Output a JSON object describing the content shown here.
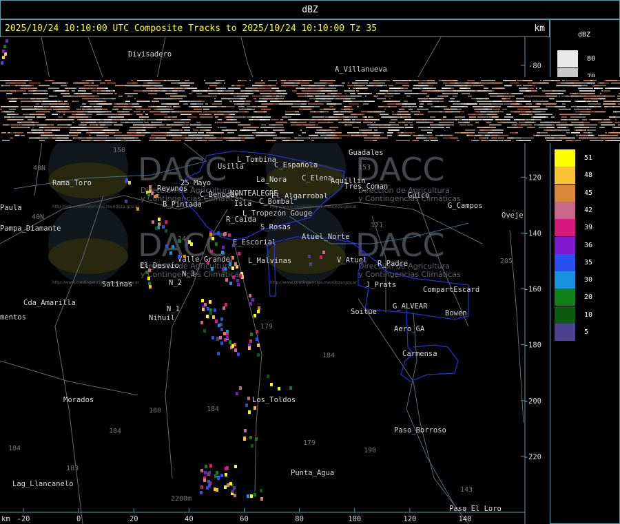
{
  "title": "dBZ",
  "header": {
    "text": "2025/10/24 10:10:00 UTC Composite Tracks to 2025/10/24 10:10:00 Tz 35",
    "unit": "km"
  },
  "legend": {
    "title": "dBZ",
    "top_entries": [
      {
        "label": "80",
        "color": "#e8e8e8"
      },
      {
        "label": "70",
        "color": "#c8c8c8"
      }
    ],
    "entries": [
      {
        "label": "51",
        "color": "#ffff00"
      },
      {
        "label": "48",
        "color": "#f7c330"
      },
      {
        "label": "45",
        "color": "#d88838"
      },
      {
        "label": "42",
        "color": "#c86888"
      },
      {
        "label": "39",
        "color": "#d8187c"
      },
      {
        "label": "36",
        "color": "#8018d0"
      },
      {
        "label": "35",
        "color": "#2850f0"
      },
      {
        "label": "30",
        "color": "#1890e0"
      },
      {
        "label": "20",
        "color": "#108018"
      },
      {
        "label": "10",
        "color": "#0a5a10"
      },
      {
        "label": "5",
        "color": "#504090"
      }
    ]
  },
  "axes": {
    "x_ticks": [
      "-20",
      "0",
      "20",
      "40",
      "60",
      "80",
      "100",
      "120",
      "140"
    ],
    "y_ticks": [
      "-80",
      "-120",
      "-140",
      "-160",
      "-180",
      "-200",
      "-220"
    ],
    "x_unit": "km"
  },
  "places": [
    {
      "name": "Divisadero",
      "x": 186,
      "y": 28
    },
    {
      "name": "A_Villanueva",
      "x": 486,
      "y": 50
    },
    {
      "name": "Guadales",
      "x": 506,
      "y": 171
    },
    {
      "name": "L_Tombina",
      "x": 344,
      "y": 181
    },
    {
      "name": "Usilla",
      "x": 316,
      "y": 191
    },
    {
      "name": "C_Española",
      "x": 398,
      "y": 189
    },
    {
      "name": "La_Nora",
      "x": 372,
      "y": 210
    },
    {
      "name": "C_Elena",
      "x": 438,
      "y": 208
    },
    {
      "name": "Aquillin",
      "x": 480,
      "y": 212
    },
    {
      "name": "Tres_Coman",
      "x": 500,
      "y": 220
    },
    {
      "name": "Rama_Toro",
      "x": 76,
      "y": 215
    },
    {
      "name": "25_Mayo",
      "x": 262,
      "y": 215
    },
    {
      "name": "Reyunos",
      "x": 228,
      "y": 223
    },
    {
      "name": "C_Benogar",
      "x": 290,
      "y": 232
    },
    {
      "name": "MONTEALEGRE",
      "x": 334,
      "y": 230
    },
    {
      "name": "El_Algarrobal",
      "x": 394,
      "y": 234
    },
    {
      "name": "Guico",
      "x": 592,
      "y": 233
    },
    {
      "name": "G_Campos",
      "x": 650,
      "y": 248
    },
    {
      "name": "Oveje",
      "x": 728,
      "y": 262
    },
    {
      "name": "C_Bombal",
      "x": 376,
      "y": 242
    },
    {
      "name": "B_Pintada",
      "x": 236,
      "y": 246
    },
    {
      "name": "Isla",
      "x": 340,
      "y": 245
    },
    {
      "name": "L_Tropezón Gouge",
      "x": 352,
      "y": 259
    },
    {
      "name": "Paula",
      "x": 0,
      "y": 251
    },
    {
      "name": "R_Caída",
      "x": 328,
      "y": 268
    },
    {
      "name": "Pampa_Diamante",
      "x": 0,
      "y": 281
    },
    {
      "name": "S_Rosas",
      "x": 378,
      "y": 279
    },
    {
      "name": "Atuel_Norte",
      "x": 438,
      "y": 293
    },
    {
      "name": "E_Escorial",
      "x": 338,
      "y": 301
    },
    {
      "name": "Valle_Grande",
      "x": 258,
      "y": 326
    },
    {
      "name": "L_Malvinas",
      "x": 360,
      "y": 328
    },
    {
      "name": "V_Atuel",
      "x": 489,
      "y": 327
    },
    {
      "name": "R_Padre",
      "x": 548,
      "y": 332
    },
    {
      "name": "El_Desvío",
      "x": 203,
      "y": 335
    },
    {
      "name": "N_3",
      "x": 264,
      "y": 347
    },
    {
      "name": "Salinas",
      "x": 148,
      "y": 362
    },
    {
      "name": "N_2",
      "x": 245,
      "y": 360
    },
    {
      "name": "J_Prats",
      "x": 531,
      "y": 363
    },
    {
      "name": "CompartEscard",
      "x": 614,
      "y": 370
    },
    {
      "name": "Cda_Amarilla",
      "x": 34,
      "y": 389
    },
    {
      "name": "G_ALVEAR",
      "x": 570,
      "y": 394
    },
    {
      "name": "N_1",
      "x": 242,
      "y": 398
    },
    {
      "name": "Soitue",
      "x": 509,
      "y": 402
    },
    {
      "name": "Bowen",
      "x": 646,
      "y": 404
    },
    {
      "name": "mentos",
      "x": 0,
      "y": 410
    },
    {
      "name": "Nihuil",
      "x": 216,
      "y": 411
    },
    {
      "name": "Aero_GA",
      "x": 572,
      "y": 427
    },
    {
      "name": "Carmensa",
      "x": 584,
      "y": 463
    },
    {
      "name": "Los_Toldos",
      "x": 366,
      "y": 530
    },
    {
      "name": "Morados",
      "x": 92,
      "y": 530
    },
    {
      "name": "Paso_Borroso",
      "x": 572,
      "y": 574
    },
    {
      "name": "Punta_Agua",
      "x": 422,
      "y": 636
    },
    {
      "name": "Lag_Llancanelo",
      "x": 18,
      "y": 652
    },
    {
      "name": "Paso_El_Loro",
      "x": 652,
      "y": 688
    }
  ],
  "route_numbers": [
    {
      "label": "150",
      "x": 164,
      "y": 167
    },
    {
      "label": "153",
      "x": 520,
      "y": 192
    },
    {
      "label": "40N",
      "x": 48,
      "y": 193
    },
    {
      "label": "40N",
      "x": 46,
      "y": 264
    },
    {
      "label": "171",
      "x": 538,
      "y": 276
    },
    {
      "label": "14",
      "x": 258,
      "y": 296
    },
    {
      "label": "205",
      "x": 726,
      "y": 328
    },
    {
      "label": "179",
      "x": 378,
      "y": 423
    },
    {
      "label": "184",
      "x": 468,
      "y": 465
    },
    {
      "label": "180",
      "x": 216,
      "y": 545
    },
    {
      "label": "184",
      "x": 300,
      "y": 543
    },
    {
      "label": "184",
      "x": 158,
      "y": 575
    },
    {
      "label": "179",
      "x": 440,
      "y": 592
    },
    {
      "label": "190",
      "x": 528,
      "y": 603
    },
    {
      "label": "184",
      "x": 12,
      "y": 600
    },
    {
      "label": "183",
      "x": 96,
      "y": 629
    },
    {
      "label": "143",
      "x": 668,
      "y": 660
    },
    {
      "label": "2200m",
      "x": 248,
      "y": 673
    }
  ],
  "watermark": {
    "brand": "DACC",
    "line1": "Dirección de Agricultura",
    "line2": "y Contingencias Climáticas",
    "url": "http://www.contingencias.mendoza.gov.ar"
  }
}
